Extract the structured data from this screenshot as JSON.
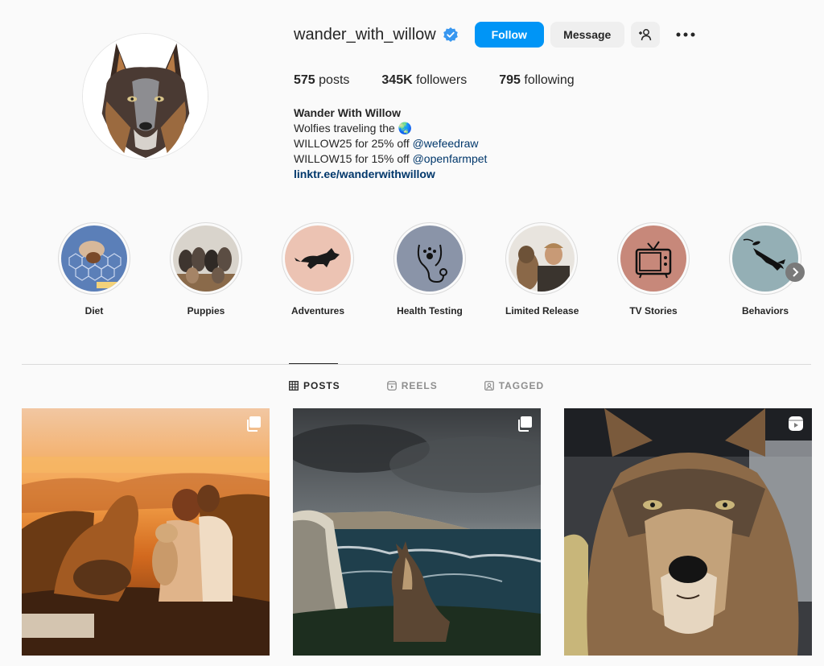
{
  "profile": {
    "username": "wander_with_willow",
    "verified": true,
    "display_name": "Wander With Willow",
    "bio_line1": "Wolfies traveling the 🌏",
    "bio_line2_text": "WILLOW25 for 25% off ",
    "bio_line2_mention": "@wefeedraw",
    "bio_line3_text": "WILLOW15 for 15% off ",
    "bio_line3_mention": "@openfarmpet",
    "link": "linktr.ee/wanderwithwillow"
  },
  "actions": {
    "follow": "Follow",
    "message": "Message",
    "add_user_icon": "add-user-icon",
    "more_icon": "more-horizontal-icon"
  },
  "stats": {
    "posts_count": "575",
    "posts_label": " posts",
    "followers_count": "345K",
    "followers_label": " followers",
    "following_count": "795",
    "following_label": " following"
  },
  "highlights": [
    {
      "label": "Diet"
    },
    {
      "label": "Puppies"
    },
    {
      "label": "Adventures"
    },
    {
      "label": "Health Testing"
    },
    {
      "label": "Limited Release"
    },
    {
      "label": "TV Stories"
    },
    {
      "label": "Behaviors"
    }
  ],
  "tabs": [
    {
      "label": "POSTS",
      "icon": "grid-icon",
      "active": true
    },
    {
      "label": "REELS",
      "icon": "reels-icon",
      "active": false
    },
    {
      "label": "TAGGED",
      "icon": "tagged-icon",
      "active": false
    }
  ],
  "posts": [
    {
      "badge": "carousel-icon"
    },
    {
      "badge": "carousel-icon"
    },
    {
      "badge": "reel-icon"
    }
  ],
  "colors": {
    "accent": "#0095f6",
    "verified": "#3897f0",
    "link": "#00376b"
  }
}
